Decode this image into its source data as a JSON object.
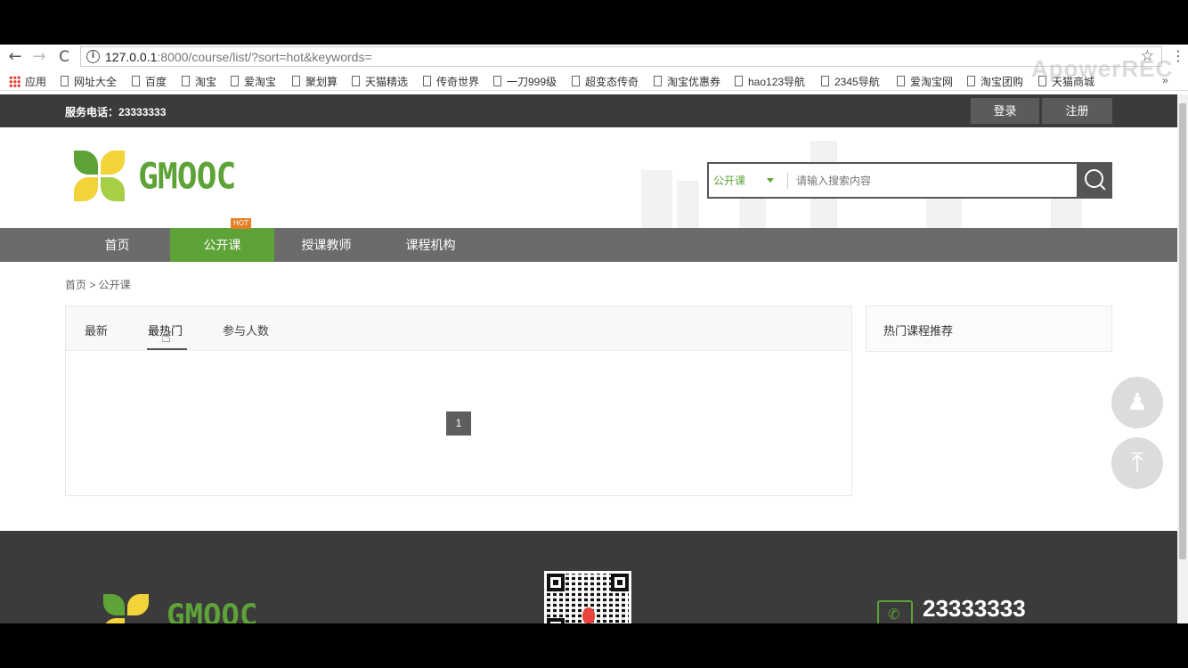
{
  "browser": {
    "url_prefix": "127.0.0.1",
    "url_rest": ":8000/course/list/?sort=hot&keywords=",
    "nav_back": "←",
    "nav_forward": "→",
    "nav_reload": "C",
    "info_glyph": "i",
    "star_glyph": "☆",
    "menu_glyph": "⋮",
    "watermark": "ApowerREC",
    "bookmarks": [
      "应用",
      "网址大全",
      "百度",
      "淘宝",
      "爱淘宝",
      "聚划算",
      "天猫精选",
      "传奇世界",
      "一刀999级",
      "超变态传奇",
      "淘宝优惠券",
      "hao123导航",
      "2345导航",
      "爱淘宝网",
      "淘宝团购",
      "天猫商城"
    ],
    "overflow": "»"
  },
  "topbar": {
    "phone_label": "服务电话：",
    "phone_number": "23333333",
    "login": "登录",
    "register": "注册"
  },
  "header": {
    "logo_text": "GMOOC",
    "search_type": "公开课",
    "search_placeholder": "请输入搜索内容"
  },
  "nav": {
    "items": [
      "首页",
      "公开课",
      "授课教师",
      "课程机构"
    ],
    "active_index": 1,
    "hot_badge": "HOT"
  },
  "breadcrumb": "首页 > 公开课",
  "sort_tabs": [
    "最新",
    "最热门",
    "参与人数"
  ],
  "pagination": {
    "current": "1"
  },
  "sidebar": {
    "title": "热门课程推荐"
  },
  "footer": {
    "logo_text": "GMOOC",
    "phone": "23333333"
  },
  "colors": {
    "brand_green": "#5ea337",
    "logo_yellow": "#f3d33a",
    "dark_bar": "#3b3b3b",
    "nav_gray": "#6b6b6b",
    "hot_orange": "#e57e24"
  }
}
